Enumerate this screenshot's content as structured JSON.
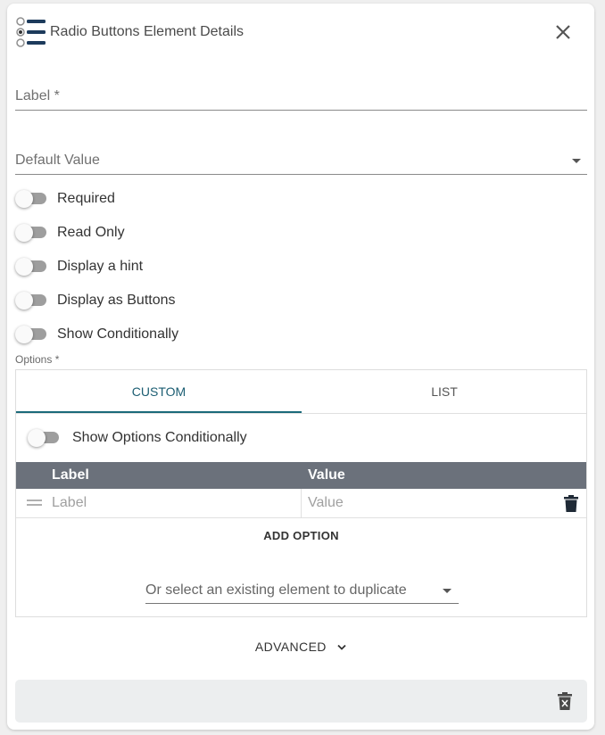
{
  "header": {
    "title": "Radio Buttons Element Details",
    "icon": "radio-buttons-icon",
    "close_icon": "close-icon"
  },
  "fields": {
    "label_placeholder": "Label *",
    "default_value_placeholder": "Default Value"
  },
  "toggles": [
    {
      "label": "Required",
      "on": false
    },
    {
      "label": "Read Only",
      "on": false
    },
    {
      "label": "Display a hint",
      "on": false
    },
    {
      "label": "Display as Buttons",
      "on": false
    },
    {
      "label": "Show Conditionally",
      "on": false
    }
  ],
  "options": {
    "section_label": "Options *",
    "tabs": [
      {
        "label": "CUSTOM",
        "active": true
      },
      {
        "label": "LIST",
        "active": false
      }
    ],
    "show_conditionally_label": "Show Options Conditionally",
    "table": {
      "headers": {
        "label": "Label",
        "value": "Value"
      },
      "rows": [
        {
          "label_placeholder": "Label",
          "value_placeholder": "Value"
        }
      ]
    },
    "add_option_label": "ADD OPTION",
    "duplicate_placeholder": "Or select an existing element to duplicate"
  },
  "advanced_label": "ADVANCED",
  "colors": {
    "accent": "#1b6a7a",
    "table_header": "#6b717b",
    "icon_navy": "#1d3b5c"
  }
}
